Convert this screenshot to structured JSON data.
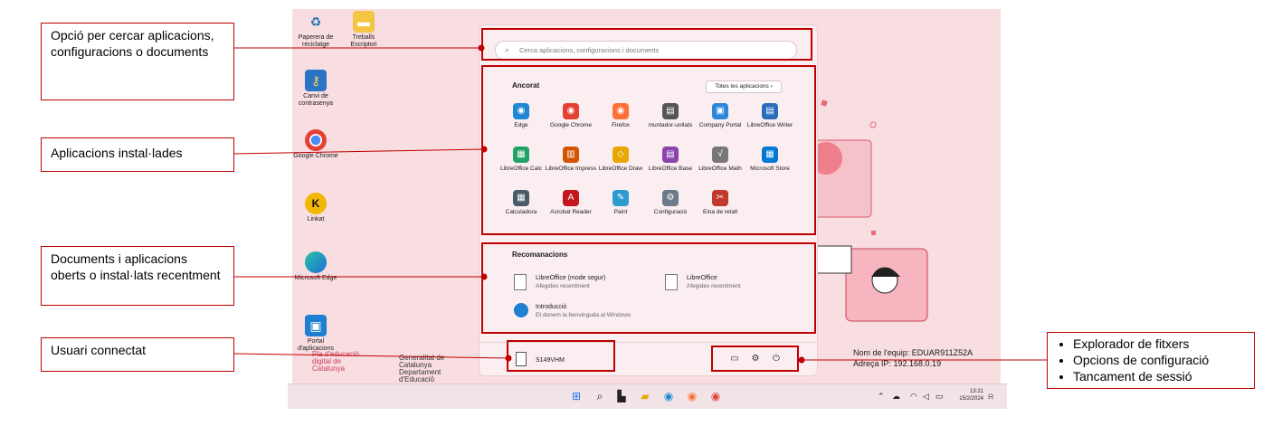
{
  "desktop": {
    "icons": [
      {
        "label": "Paperera de reciclatge",
        "icon": "recycle-bin-icon"
      },
      {
        "label": "Treballs Escriptori",
        "icon": "folder-icon"
      },
      {
        "label": "Canvi de contrasenya",
        "icon": "key-icon"
      },
      {
        "label": "Google Chrome",
        "icon": "chrome-icon"
      },
      {
        "label": "Linkat",
        "icon": "linkat-icon"
      },
      {
        "label": "Microsoft Edge",
        "icon": "edge-icon"
      },
      {
        "label": "Portal d'aplicacions",
        "icon": "portal-icon"
      }
    ],
    "watermark_left": "Pla d'educació digital de Catalunya",
    "watermark_right": "Generalitat de Catalunya Departament d'Educació",
    "pc_name": "Nom de l'equip: EDUAR911Z52A",
    "ip": "Adreça IP: 192.168.0.19"
  },
  "start_menu": {
    "search_placeholder": "Cerca aplicacions, configuracions i documents",
    "pinned_title": "Ancorat",
    "all_apps_label": "Totes les aplicacions",
    "pinned_apps": [
      {
        "label": "Edge",
        "icon": "edge-icon",
        "color": "#1e88d6"
      },
      {
        "label": "Google Chrome",
        "icon": "chrome-icon",
        "color": "#e34133"
      },
      {
        "label": "Firefox",
        "icon": "firefox-icon",
        "color": "#ff7139"
      },
      {
        "label": "muntador-unitats",
        "icon": "drive-icon",
        "color": "#555555"
      },
      {
        "label": "Company Portal",
        "icon": "company-portal-icon",
        "color": "#2b88d8"
      },
      {
        "label": "LibreOffice Writer",
        "icon": "writer-icon",
        "color": "#2a6ebb"
      },
      {
        "label": "LibreOffice Calc",
        "icon": "calc-icon",
        "color": "#21a366"
      },
      {
        "label": "LibreOffice Impress",
        "icon": "impress-icon",
        "color": "#d35400"
      },
      {
        "label": "LibreOffice Draw",
        "icon": "draw-icon",
        "color": "#e6a700"
      },
      {
        "label": "LibreOffice Base",
        "icon": "base-icon",
        "color": "#8e44ad"
      },
      {
        "label": "LibreOffice Math",
        "icon": "math-icon",
        "color": "#777777"
      },
      {
        "label": "Microsoft Store",
        "icon": "store-icon",
        "color": "#0078d4"
      },
      {
        "label": "Calculadora",
        "icon": "calculator-icon",
        "color": "#4a5a6a"
      },
      {
        "label": "Acrobat Reader",
        "icon": "acrobat-icon",
        "color": "#c4161c"
      },
      {
        "label": "Paint",
        "icon": "paint-icon",
        "color": "#2e9ad0"
      },
      {
        "label": "Configuració",
        "icon": "gear-icon",
        "color": "#6c7a89"
      },
      {
        "label": "Eina de retall",
        "icon": "snipping-icon",
        "color": "#c0392b"
      }
    ],
    "recommended_title": "Recomanacions",
    "recommended": [
      {
        "title": "LibreOffice (mode segur)",
        "subtitle": "Afegides recentment"
      },
      {
        "title": "LibreOffice",
        "subtitle": "Afegides recentment"
      },
      {
        "title": "Introducció",
        "subtitle": "Et donem la benvinguda al Windows"
      }
    ],
    "user_name": "S149VHM"
  },
  "taskbar": {
    "time": "13:21",
    "date": "15/2/2024"
  },
  "callouts": {
    "search": "Opció per cercar aplicacions, configuracions o documents",
    "apps": "Aplicacions instal·lades",
    "recent": "Documents i aplicacions oberts o instal·lats recentment",
    "user": "Usuari connectat",
    "bullets": [
      "Explorador de fitxers",
      "Opcions de configuració",
      "Tancament de sessió"
    ]
  },
  "colors": {
    "annotation": "#c00000",
    "desktop_bg": "#f8dde1"
  }
}
